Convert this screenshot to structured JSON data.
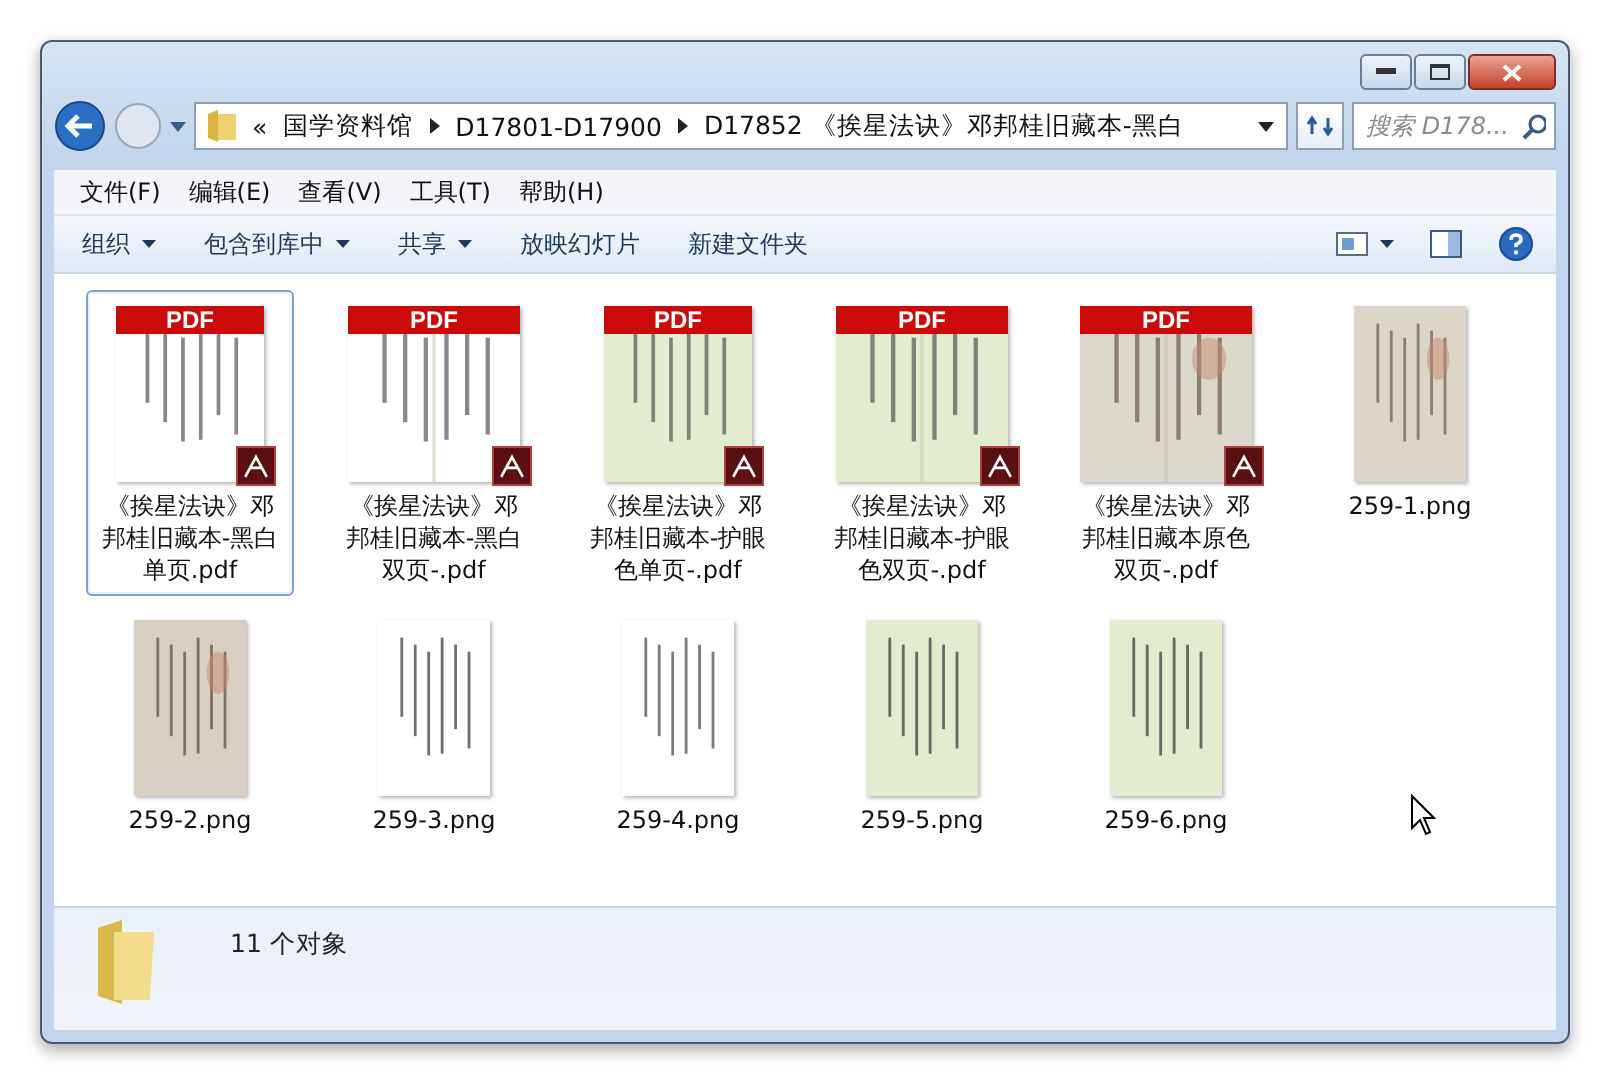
{
  "address": {
    "overflow": "«",
    "crumbs": [
      "国学资料馆",
      "D17801-D17900",
      "D17852 《挨星法诀》邓邦桂旧藏本-黑白"
    ]
  },
  "search": {
    "placeholder": "搜索 D178..."
  },
  "menu": [
    "文件(F)",
    "编辑(E)",
    "查看(V)",
    "工具(T)",
    "帮助(H)"
  ],
  "toolbar": [
    {
      "label": "组织",
      "has_menu": true
    },
    {
      "label": "包含到库中",
      "has_menu": true
    },
    {
      "label": "共享",
      "has_menu": true
    },
    {
      "label": "放映幻灯片",
      "has_menu": false
    },
    {
      "label": "新建文件夹",
      "has_menu": false
    }
  ],
  "files": [
    {
      "kind": "pdf",
      "badge": "PDF",
      "name": "《挨星法诀》邓邦桂旧藏本-黑白单页.pdf",
      "selected": true
    },
    {
      "kind": "pdf",
      "badge": "PDF",
      "name": "《挨星法诀》邓邦桂旧藏本-黑白双页-.pdf",
      "selected": false
    },
    {
      "kind": "pdf",
      "badge": "PDF",
      "name": "《挨星法诀》邓邦桂旧藏本-护眼色单页-.pdf",
      "selected": false
    },
    {
      "kind": "pdf",
      "badge": "PDF",
      "name": "《挨星法诀》邓邦桂旧藏本-护眼色双页-.pdf",
      "selected": false
    },
    {
      "kind": "pdf",
      "badge": "PDF",
      "name": "《挨星法诀》邓邦桂旧藏本原色双页-.pdf",
      "selected": false
    },
    {
      "kind": "png",
      "name": "259-1.png",
      "selected": false
    },
    {
      "kind": "png",
      "name": "259-2.png",
      "selected": false
    },
    {
      "kind": "png",
      "name": "259-3.png",
      "selected": false
    },
    {
      "kind": "png",
      "name": "259-4.png",
      "selected": false
    },
    {
      "kind": "png",
      "name": "259-5.png",
      "selected": false
    },
    {
      "kind": "png",
      "name": "259-6.png",
      "selected": false
    }
  ],
  "status": {
    "count": "11 个对象"
  }
}
